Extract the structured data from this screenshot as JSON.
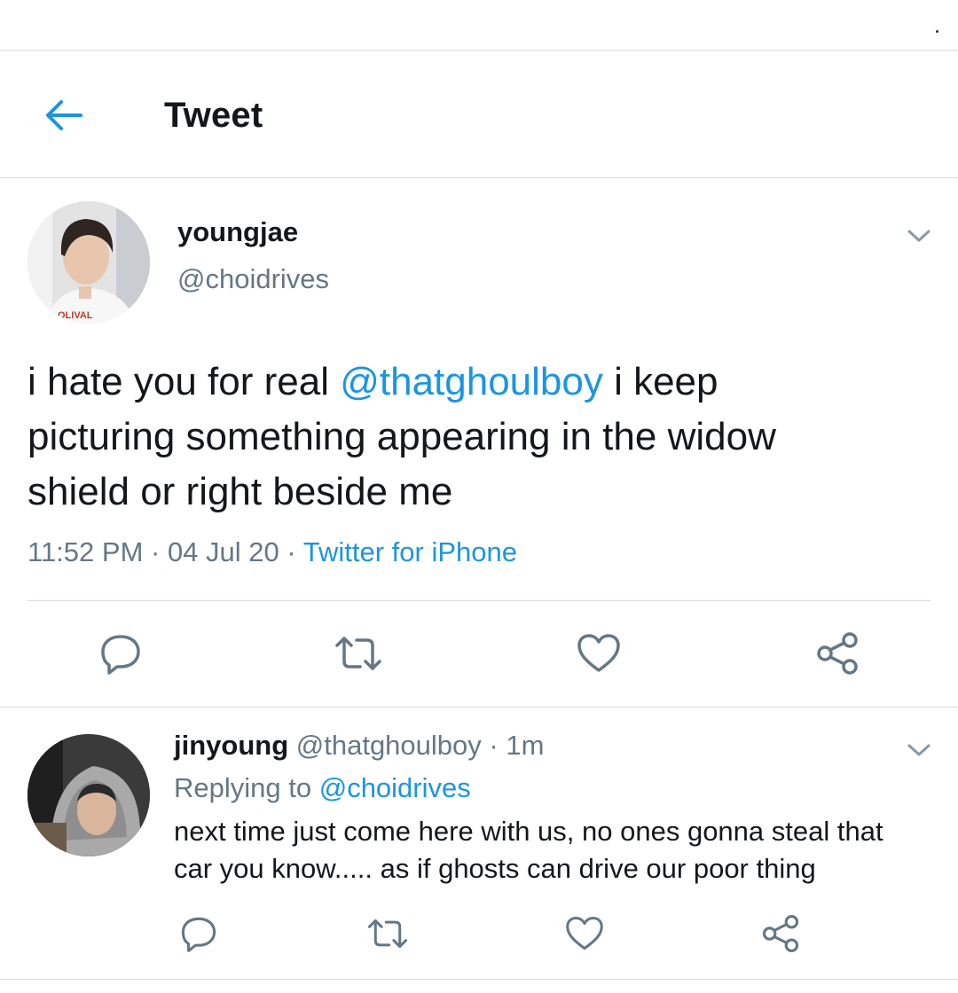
{
  "header": {
    "title": "Tweet"
  },
  "tweet": {
    "author_name": "youngjae",
    "author_handle": "@choidrives",
    "text_line1_before": "i hate you for real ",
    "text_mention": "@thatghoulboy",
    "text_line1_after": " i keep",
    "text_line2": "picturing something appearing in the widow",
    "text_line3": "shield or right beside me",
    "time": "11:52 PM",
    "sep1": " · ",
    "date": "04 Jul 20",
    "sep2": " · ",
    "source": "Twitter for iPhone"
  },
  "reply": {
    "author_name": "jinyoung",
    "author_handle": " @thatghoulboy",
    "dot": " · ",
    "age": "1m",
    "replying_prefix": "Replying to ",
    "replying_handle": "@choidrives",
    "text_line1": "next time just come here with us, no ones gonna steal that",
    "text_line2": "car you know..... as if ghosts can drive our poor thing"
  },
  "icons": {
    "back": "arrow-left-icon",
    "caret": "chevron-down-icon",
    "reply": "speech-bubble-icon",
    "retweet": "retweet-icon",
    "like": "heart-icon",
    "share": "share-icon"
  },
  "colors": {
    "accent": "#1b95e0",
    "text": "#14171a",
    "secondary": "#657786",
    "divider": "#d6dde3"
  }
}
